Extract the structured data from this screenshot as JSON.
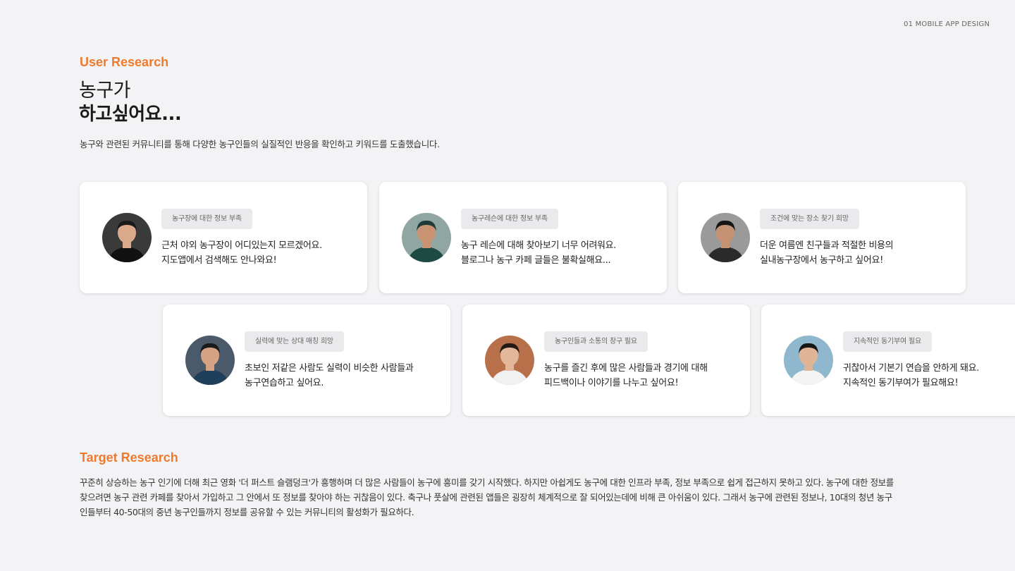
{
  "header": {
    "top_label": "01 MOBILE APP DESIGN"
  },
  "user_research": {
    "label": "User Research",
    "headline_line1": "농구가",
    "headline_line2": "하고싶어요...",
    "intro": "농구와 관련된 커뮤니티를 통해 다양한 농구인들의 실질적인 반응을 확인하고 키워드를 도출했습니다."
  },
  "cards": [
    {
      "tag": "농구장에 대한 정보 부족",
      "line1": "근처 야외 농구장이 어디있는지 모르겠어요.",
      "line2": "지도앱에서 검색해도 안나와요!",
      "avatar_bg": "#3a3a3a",
      "skin": "#d9a98a",
      "hair": "#1a1a1a",
      "shirt": "#111111"
    },
    {
      "tag": "농구레슨에 대한 정보 부족",
      "line1": "농구 레슨에 대해 찾아보기 너무 어려워요.",
      "line2": "블로그나 농구 카페 글들은 불확실해요...",
      "avatar_bg": "#8fa6a2",
      "skin": "#c99373",
      "hair": "#1f3b38",
      "shirt": "#1e4a44"
    },
    {
      "tag": "조건에 맞는 장소 찾기 희망",
      "line1": "더운 여름엔 친구들과 적절한 비용의",
      "line2": "실내농구장에서 농구하고 싶어요!",
      "avatar_bg": "#9a9a9a",
      "skin": "#c49273",
      "hair": "#151515",
      "shirt": "#2a2a2a"
    },
    {
      "tag": "실력에 맞는 상대 매칭 희망",
      "line1": "초보인 저같은 사람도 실력이 비슷한 사람들과",
      "line2": "농구연습하고 싶어요.",
      "avatar_bg": "#4a5a6a",
      "skin": "#d5a284",
      "hair": "#1a1a1a",
      "shirt": "#1f3f5a"
    },
    {
      "tag": "농구인들과 소통의 창구 필요",
      "line1": "농구를 즐긴 후에 많은 사람들과 경기에 대해",
      "line2": "피드백이나 이야기를 나누고 싶어요!",
      "avatar_bg": "#b8704a",
      "skin": "#e2b79a",
      "hair": "#241a14",
      "shirt": "#f1f1f1"
    },
    {
      "tag": "지속적인 동기부여 필요",
      "line1": "귀찮아서 기본기 연습을 안하게 돼요.",
      "line2": "지속적인 동기부여가 필요해요!",
      "avatar_bg": "#8fb8cf",
      "skin": "#e0b596",
      "hair": "#171717",
      "shirt": "#f4f4f4"
    }
  ],
  "target_research": {
    "label": "Target Research",
    "line1": "꾸준히 상승하는 농구 인기에 더해 최근 영화 '더 퍼스트 슬램덩크'가 흥행하며 더 많은 사람들이 농구에 흥미를 갖기 시작했다. 하지만 아쉽게도 농구에 대한 인프라 부족, 정보 부족으로 쉽게 접근하지 못하고 있다. 농구에 대한 정보를",
    "line2": "찾으려면 농구 관련 카페를 찾아서 가입하고 그 안에서 또 정보를 찾아야 하는 귀찮음이 있다. 축구나 풋살에 관련된 앱들은 굉장히 체계적으로 잘 되어있는데에 비해 큰 아쉬움이 있다. 그래서 농구에 관련된 정보나, 10대의 청년 농구",
    "line3": "인들부터 40-50대의 중년 농구인들까지 정보를 공유할 수 있는 커뮤니티의 활성화가 필요하다."
  }
}
